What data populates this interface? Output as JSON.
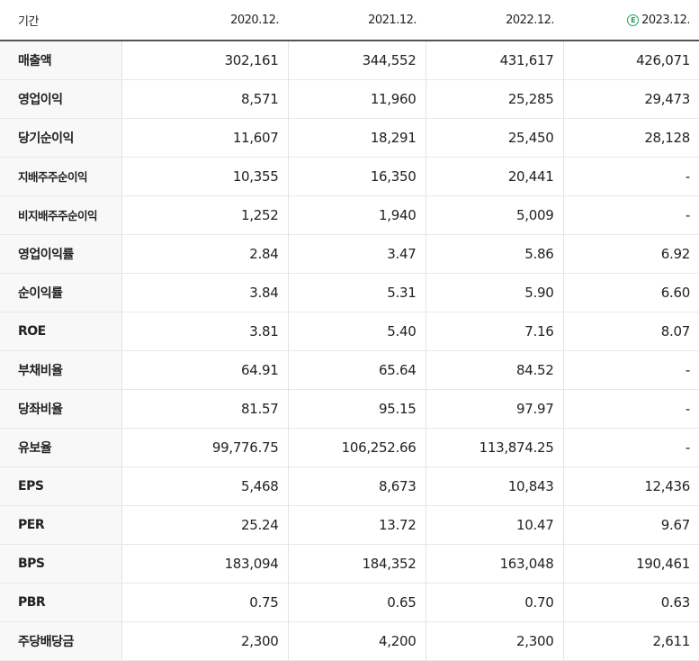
{
  "header": {
    "label": "기간",
    "periods": [
      "2020.12.",
      "2021.12.",
      "2022.12.",
      "2023.12."
    ],
    "estimate_badge": "E"
  },
  "rows": [
    {
      "label": "매출액",
      "values": [
        "302,161",
        "344,552",
        "431,617",
        "426,071"
      ]
    },
    {
      "label": "영업이익",
      "values": [
        "8,571",
        "11,960",
        "25,285",
        "29,473"
      ]
    },
    {
      "label": "당기순이익",
      "values": [
        "11,607",
        "18,291",
        "25,450",
        "28,128"
      ]
    },
    {
      "label": "지배주주순이익",
      "values": [
        "10,355",
        "16,350",
        "20,441",
        "-"
      ]
    },
    {
      "label": "비지배주주순이익",
      "values": [
        "1,252",
        "1,940",
        "5,009",
        "-"
      ]
    },
    {
      "label": "영업이익률",
      "values": [
        "2.84",
        "3.47",
        "5.86",
        "6.92"
      ]
    },
    {
      "label": "순이익률",
      "values": [
        "3.84",
        "5.31",
        "5.90",
        "6.60"
      ]
    },
    {
      "label": "ROE",
      "values": [
        "3.81",
        "5.40",
        "7.16",
        "8.07"
      ]
    },
    {
      "label": "부채비율",
      "values": [
        "64.91",
        "65.64",
        "84.52",
        "-"
      ]
    },
    {
      "label": "당좌비율",
      "values": [
        "81.57",
        "95.15",
        "97.97",
        "-"
      ]
    },
    {
      "label": "유보율",
      "values": [
        "99,776.75",
        "106,252.66",
        "113,874.25",
        "-"
      ]
    },
    {
      "label": "EPS",
      "values": [
        "5,468",
        "8,673",
        "10,843",
        "12,436"
      ]
    },
    {
      "label": "PER",
      "values": [
        "25.24",
        "13.72",
        "10.47",
        "9.67"
      ]
    },
    {
      "label": "BPS",
      "values": [
        "183,094",
        "184,352",
        "163,048",
        "190,461"
      ]
    },
    {
      "label": "PBR",
      "values": [
        "0.75",
        "0.65",
        "0.70",
        "0.63"
      ]
    },
    {
      "label": "주당배당금",
      "values": [
        "2,300",
        "4,200",
        "2,300",
        "2,611"
      ]
    }
  ]
}
